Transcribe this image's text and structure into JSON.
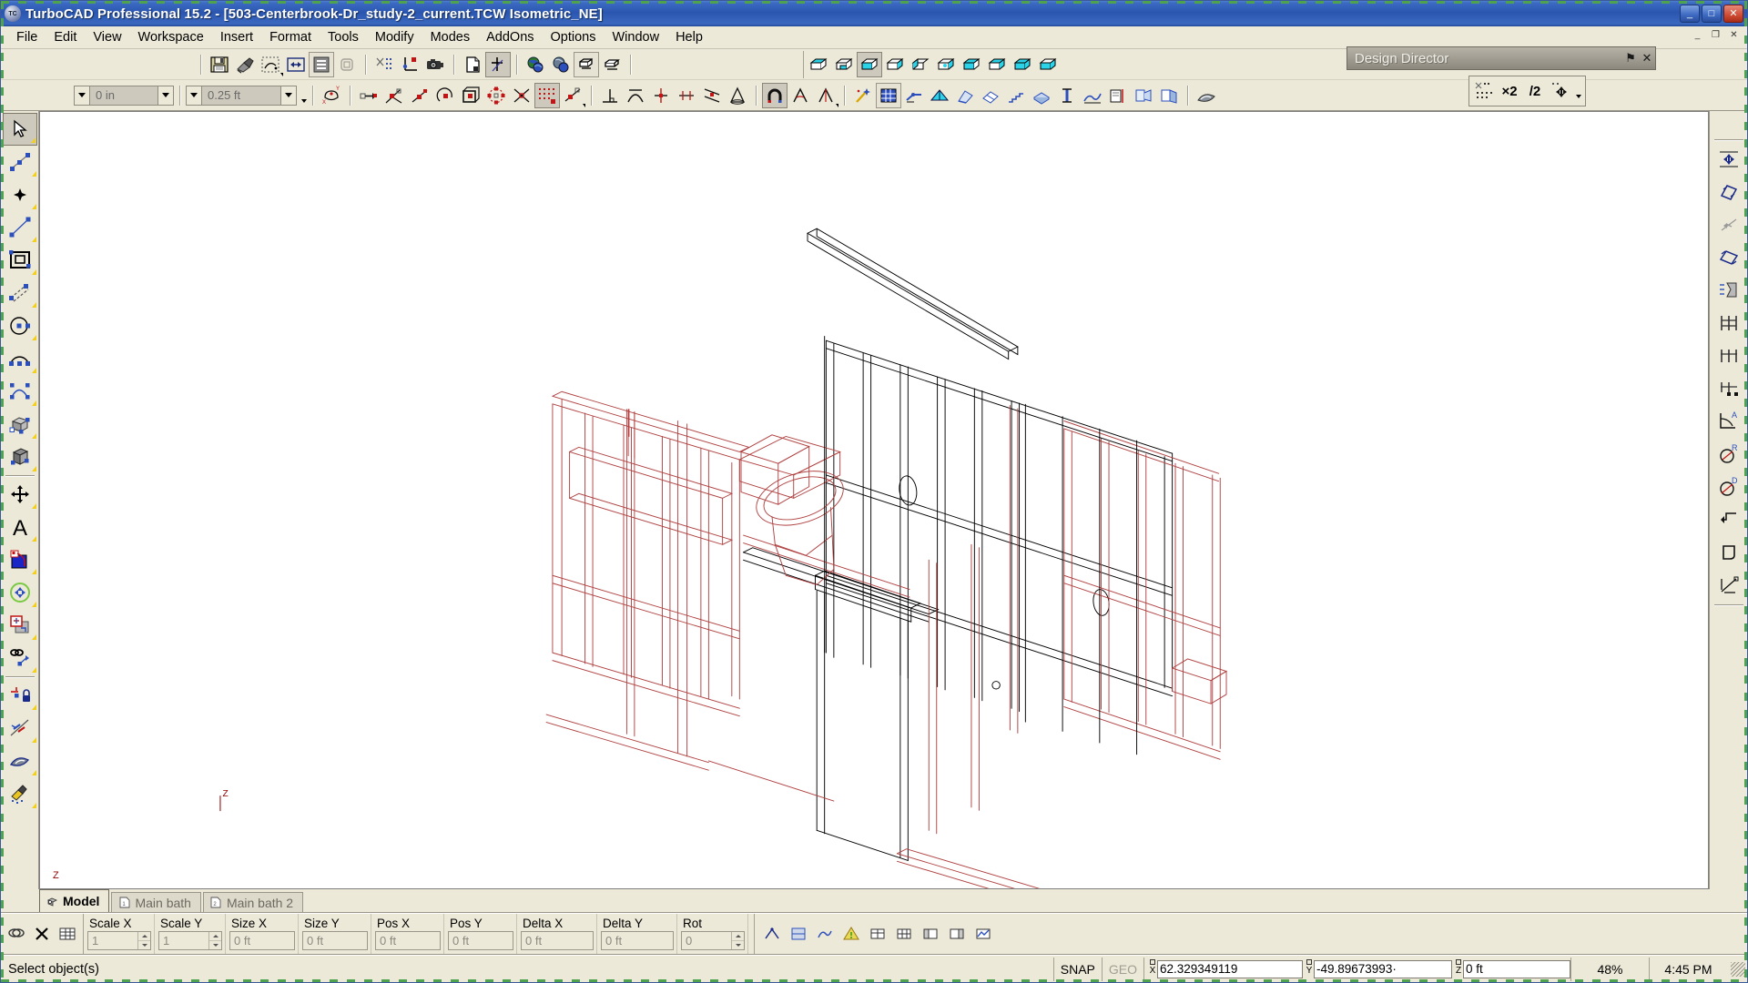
{
  "window": {
    "app_title": "TurboCAD Professional 15.2 - [503-Centerbrook-Dr_study-2_current.TCW Isometric_NE]",
    "app_icon": "turbocad-logo-icon",
    "minimize_label": "_",
    "maximize_label": "□",
    "close_label": "✕",
    "mdi_minimize": "_",
    "mdi_restore": "❐",
    "mdi_close": "✕"
  },
  "menu": {
    "items": [
      {
        "label": "File",
        "accel": "F"
      },
      {
        "label": "Edit",
        "accel": "E"
      },
      {
        "label": "View",
        "accel": "V"
      },
      {
        "label": "Workspace",
        "accel": "W"
      },
      {
        "label": "Insert",
        "accel": "I"
      },
      {
        "label": "Format",
        "accel": "o"
      },
      {
        "label": "Tools",
        "accel": "T"
      },
      {
        "label": "Modify",
        "accel": "y"
      },
      {
        "label": "Modes",
        "accel": "M"
      },
      {
        "label": "AddOns",
        "accel": "A"
      },
      {
        "label": "Options",
        "accel": "p"
      },
      {
        "label": "Window",
        "accel": "W"
      },
      {
        "label": "Help",
        "accel": "H"
      }
    ]
  },
  "standard_toolbar": {
    "buttons": [
      {
        "name": "save-icon",
        "title": "Save"
      },
      {
        "name": "format-painter-icon",
        "title": "Format Painter"
      },
      {
        "name": "select-by-icon",
        "title": "Select By"
      },
      {
        "name": "align-icon",
        "title": "Align"
      },
      {
        "name": "properties-icon",
        "title": "Properties"
      },
      {
        "name": "explode-icon",
        "title": "Explode"
      },
      {
        "name": "blocks-icon",
        "title": "Blocks"
      },
      {
        "name": "workplane-icon",
        "title": "Set Workplane"
      },
      {
        "name": "camera-icon",
        "title": "Camera"
      },
      {
        "name": "new-sheet-icon",
        "title": "New Sheet"
      },
      {
        "name": "local-ucs-icon",
        "title": "Local Coordinate System"
      },
      {
        "name": "render-globe-icon",
        "title": "Render Scene"
      },
      {
        "name": "render-globe-2-icon",
        "title": "Quality Render"
      },
      {
        "name": "hidden-line-icon",
        "title": "Hidden Line"
      },
      {
        "name": "wireframe-icon",
        "title": "Wireframe"
      }
    ]
  },
  "view_toolbar": {
    "buttons": [
      {
        "name": "view-top-icon",
        "title": "Top View"
      },
      {
        "name": "view-bottom-icon",
        "title": "Bottom View"
      },
      {
        "name": "view-front-icon",
        "title": "Front View"
      },
      {
        "name": "view-back-icon",
        "title": "Back View"
      },
      {
        "name": "view-left-icon",
        "title": "Left View"
      },
      {
        "name": "view-right-icon",
        "title": "Right View"
      },
      {
        "name": "view-iso-sw-icon",
        "title": "SW Isometric"
      },
      {
        "name": "view-iso-se-icon",
        "title": "SE Isometric"
      },
      {
        "name": "view-iso-ne-icon",
        "title": "NE Isometric"
      },
      {
        "name": "view-iso-nw-icon",
        "title": "NW Isometric"
      }
    ]
  },
  "mini_toolbar": {
    "buttons": [
      {
        "name": "grid-snap-icon",
        "title": "Grid Snap"
      },
      {
        "name": "grid-x2-icon",
        "title": "Grid x2",
        "label": "×2"
      },
      {
        "name": "grid-div2-icon",
        "title": "Grid /2",
        "label": "/2"
      },
      {
        "name": "grid-move-icon",
        "title": "Move Grid"
      }
    ]
  },
  "property_combos": [
    {
      "name": "line-width-combo",
      "value": "0 in"
    },
    {
      "name": "layer-height-combo",
      "value": "0.25 ft"
    }
  ],
  "snap_toolbar": {
    "buttons": [
      {
        "name": "snap-workplane-icon",
        "title": "Workplane by Facet"
      },
      {
        "name": "snap-point-icon",
        "title": "Snap to Point"
      },
      {
        "name": "snap-vertex-icon",
        "title": "Snap to Vertex"
      },
      {
        "name": "snap-midpoint-icon",
        "title": "Snap to Midpoint"
      },
      {
        "name": "snap-arc-center-icon",
        "title": "Snap to Arc Center"
      },
      {
        "name": "snap-box-icon",
        "title": "Snap to Bounding Box"
      },
      {
        "name": "snap-circle-quadrant-icon",
        "title": "Snap to Quadrant"
      },
      {
        "name": "snap-intersection-icon",
        "title": "Snap to Intersection"
      },
      {
        "name": "snap-grid-icon",
        "title": "Snap to Grid"
      },
      {
        "name": "snap-nearest-icon",
        "title": "Snap to Nearest"
      },
      {
        "name": "snap-perpendicular-icon",
        "title": "Snap Perpendicular"
      },
      {
        "name": "snap-tangent-icon",
        "title": "Snap Tangent"
      },
      {
        "name": "snap-edge-icon",
        "title": "Snap to Edge"
      },
      {
        "name": "snap-division-icon",
        "title": "Snap Division"
      },
      {
        "name": "snap-parallel-icon",
        "title": "Snap Parallel"
      },
      {
        "name": "snap-cone-icon",
        "title": "Snap to Cone"
      },
      {
        "name": "magnet-snap-icon",
        "title": "Magnetic Snap"
      },
      {
        "name": "snap-angle-icon",
        "title": "Snap Angle"
      },
      {
        "name": "snap-angle-2-icon",
        "title": "Snap Angle 2"
      },
      {
        "name": "magic-wand-icon",
        "title": "Auto Snap"
      },
      {
        "name": "grid-overlay-icon",
        "title": "Grid Overlay"
      },
      {
        "name": "wall-tool-icon",
        "title": "Wall Tool"
      },
      {
        "name": "roof-tool-icon",
        "title": "Roof Tool"
      },
      {
        "name": "door-tool-icon",
        "title": "Door Tool"
      },
      {
        "name": "window-tool-icon",
        "title": "Window Tool"
      },
      {
        "name": "stair-tool-icon",
        "title": "Stair Tool"
      },
      {
        "name": "slab-tool-icon",
        "title": "Slab Tool"
      },
      {
        "name": "column-tool-icon",
        "title": "Column Tool"
      },
      {
        "name": "terrain-tool-icon",
        "title": "Terrain Tool"
      },
      {
        "name": "section-tool-icon",
        "title": "Section Tool"
      },
      {
        "name": "detail-tool-icon",
        "title": "Detail Tool"
      },
      {
        "name": "photo-render-icon",
        "title": "Photo Render"
      },
      {
        "name": "material-icon",
        "title": "Materials"
      }
    ]
  },
  "left_toolbar": {
    "buttons": [
      {
        "name": "select-tool-icon",
        "title": "Select",
        "selected": true
      },
      {
        "name": "line-tool-icon",
        "title": "Line"
      },
      {
        "name": "point-tool-icon",
        "title": "Point"
      },
      {
        "name": "single-line-tool-icon",
        "title": "Single Line"
      },
      {
        "name": "rectangle-tool-icon",
        "title": "Rectangle"
      },
      {
        "name": "multiline-tool-icon",
        "title": "Multi Line"
      },
      {
        "name": "circle-tool-icon",
        "title": "Circle"
      },
      {
        "name": "arc-tool-icon",
        "title": "Arc"
      },
      {
        "name": "curve-tool-icon",
        "title": "Bezier Curve"
      },
      {
        "name": "box-3d-tool-icon",
        "title": "3D Box"
      },
      {
        "name": "extrude-tool-icon",
        "title": "Extrude"
      },
      {
        "name": "move-tool-icon",
        "title": "Move"
      },
      {
        "name": "text-tool-icon",
        "title": "Text"
      },
      {
        "name": "hatch-tool-icon",
        "title": "Hatch / Fill"
      },
      {
        "name": "explode-tool-icon",
        "title": "Explode"
      },
      {
        "name": "modify-tool-icon",
        "title": "Modify"
      },
      {
        "name": "chain-tool-icon",
        "title": "Chain"
      },
      {
        "name": "constraint-tool-icon",
        "title": "Constraint"
      },
      {
        "name": "lock-tool-icon",
        "title": "Lock"
      },
      {
        "name": "trim-tool-icon",
        "title": "Trim"
      },
      {
        "name": "shade-tool-icon",
        "title": "Shade"
      },
      {
        "name": "render-tool-icon",
        "title": "Render"
      }
    ]
  },
  "right_toolbar": {
    "buttons": [
      {
        "name": "dimension-move-icon",
        "title": "Move Dimension"
      },
      {
        "name": "dim-linear-icon",
        "title": "Linear Dimension"
      },
      {
        "name": "dim-aligned-icon",
        "title": "Aligned Dimension"
      },
      {
        "name": "dim-parallel-icon",
        "title": "Parallel Dimension"
      },
      {
        "name": "dim-leader-icon",
        "title": "Leader"
      },
      {
        "name": "dim-baseline-icon",
        "title": "Baseline Dimension"
      },
      {
        "name": "dim-continue-icon",
        "title": "Continue Dimension"
      },
      {
        "name": "dim-ordinate-icon",
        "title": "Ordinate Dimension"
      },
      {
        "name": "dim-angular-icon",
        "title": "Angular Dimension"
      },
      {
        "name": "dim-radius-icon",
        "title": "Radius Dimension"
      },
      {
        "name": "dim-diameter-icon",
        "title": "Diameter Dimension"
      },
      {
        "name": "dim-arrow-icon",
        "title": "Arrow"
      },
      {
        "name": "dim-balloon-icon",
        "title": "Balloon"
      },
      {
        "name": "dim-area-icon",
        "title": "Area Dimension"
      }
    ]
  },
  "design_director": {
    "title": "Design Director",
    "pin_icon": "⚑",
    "close_icon": "✕"
  },
  "canvas": {
    "axis_z_label": "Z",
    "drawing_description": "Isometric wireframe of framed bathroom walls with studs, headers, door opening, toilet and vanity"
  },
  "tabs": [
    {
      "label": "Model",
      "icon": "model-3d-icon",
      "active": true
    },
    {
      "label": "Main bath",
      "icon": "sheet-1-icon",
      "active": false
    },
    {
      "label": "Main bath 2",
      "icon": "sheet-2-icon",
      "active": false
    }
  ],
  "property_bar": {
    "left_icons": [
      {
        "name": "prop-pointer-icon",
        "title": "Selection Info"
      },
      {
        "name": "prop-delete-icon",
        "title": "Delete"
      },
      {
        "name": "prop-table-icon",
        "title": "Table"
      }
    ],
    "fields": [
      {
        "label": "Scale X",
        "value": "1",
        "spinner": true
      },
      {
        "label": "Scale Y",
        "value": "1",
        "spinner": true
      },
      {
        "label": "Size X",
        "value": "0 ft",
        "spinner": false
      },
      {
        "label": "Size Y",
        "value": "0 ft",
        "spinner": false
      },
      {
        "label": "Pos X",
        "value": "0 ft",
        "spinner": false
      },
      {
        "label": "Pos Y",
        "value": "0 ft",
        "spinner": false
      },
      {
        "label": "Delta X",
        "value": "0 ft",
        "spinner": false
      },
      {
        "label": "Delta Y",
        "value": "0 ft",
        "spinner": false
      },
      {
        "label": "Rot",
        "value": "0",
        "spinner": true
      }
    ],
    "right_icons": [
      {
        "name": "snap-ortho-icon",
        "title": "Ortho Mode"
      },
      {
        "name": "snap-polar-icon",
        "title": "Polar Tracking"
      },
      {
        "name": "snap-object-icon",
        "title": "Object Snap"
      },
      {
        "name": "warn-icon",
        "title": "Warnings"
      },
      {
        "name": "layer-icon",
        "title": "Layer Manager"
      },
      {
        "name": "grid-toggle-icon",
        "title": "Grid Toggle"
      },
      {
        "name": "panel-a-icon",
        "title": "Panel A"
      },
      {
        "name": "panel-b-icon",
        "title": "Panel B"
      },
      {
        "name": "chart-icon",
        "title": "Statistics"
      }
    ]
  },
  "statusbar": {
    "message": "Select object(s)",
    "snap_label": "SNAP",
    "geo_label": "GEO",
    "coords": [
      {
        "axis": "X",
        "value": "62.329349119"
      },
      {
        "axis": "Y",
        "value": "-49.89673993·"
      },
      {
        "axis": "Z",
        "value": "0 ft"
      }
    ],
    "zoom": "48%",
    "time": "4:45 PM"
  }
}
